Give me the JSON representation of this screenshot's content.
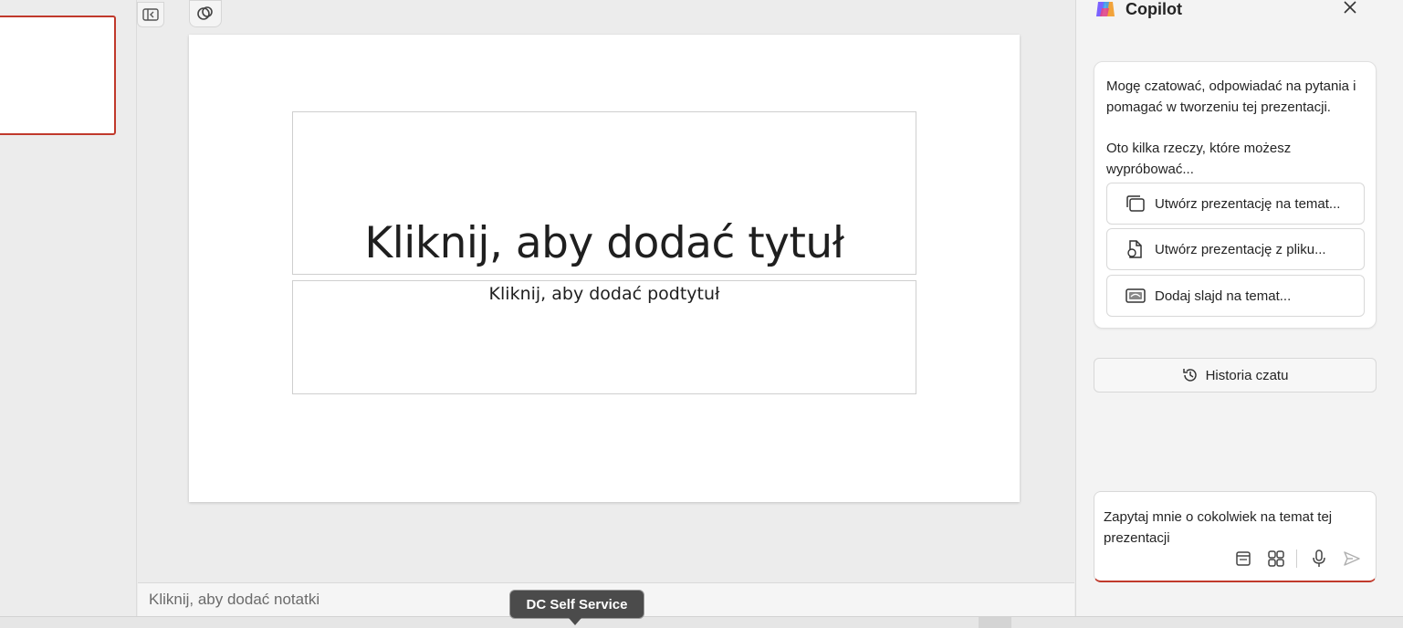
{
  "slide": {
    "title_placeholder": "Kliknij, aby dodać tytuł",
    "subtitle_placeholder": "Kliknij, aby dodać podtytuł"
  },
  "notes": {
    "placeholder": "Kliknij, aby dodać notatki"
  },
  "tooltip": {
    "text": "DC Self Service"
  },
  "copilot": {
    "title": "Copilot",
    "intro": "Mogę czatować, odpowiadać na pytania i pomagać w tworzeniu tej prezentacji.",
    "try_text": "Oto kilka rzeczy, które możesz wypróbować...",
    "suggestions": [
      {
        "label": "Utwórz prezentację na temat...",
        "icon": "slides-icon"
      },
      {
        "label": "Utwórz prezentację z pliku...",
        "icon": "file-icon"
      },
      {
        "label": "Dodaj slajd na temat...",
        "icon": "add-slide-icon"
      }
    ],
    "history_label": "Historia czatu",
    "input_placeholder": "Zapytaj mnie o cokolwiek na temat tej prezentacji"
  },
  "colors": {
    "accent": "#c0392b",
    "pane_bg": "#f3f3f3",
    "canvas_bg": "#ececec"
  }
}
